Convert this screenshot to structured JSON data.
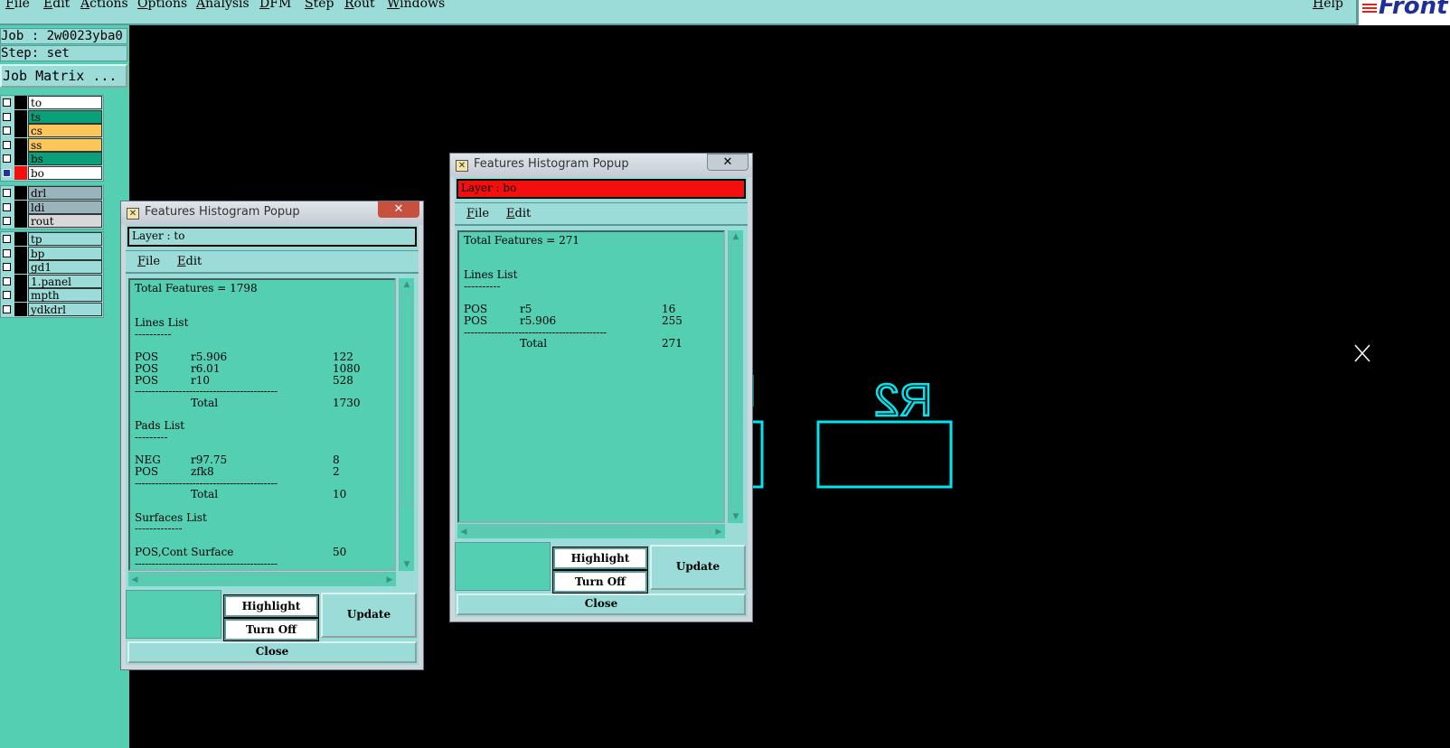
{
  "menubar": {
    "items": [
      "File",
      "Edit",
      "Actions",
      "Options",
      "Analysis",
      "DFM",
      "Step",
      "Rout",
      "Windows"
    ],
    "help": "Help",
    "logo_text": "Front"
  },
  "left_panel": {
    "job": "Job : 2w0023yba0",
    "step": "Step: set",
    "job_matrix": "Job Matrix ...",
    "layers_group1": [
      {
        "name": "to",
        "color": "#ffffff"
      },
      {
        "name": "ts",
        "color": "#0aa07a"
      },
      {
        "name": "cs",
        "color": "#fbc75b"
      },
      {
        "name": "ss",
        "color": "#fbc75b"
      },
      {
        "name": "bs",
        "color": "#0aa07a"
      },
      {
        "name": "bo",
        "color": "#ffffff"
      }
    ],
    "layers_group2": [
      {
        "name": "drl",
        "color": "#9ab4bc"
      },
      {
        "name": "ldi",
        "color": "#9ab4bc"
      },
      {
        "name": "rout",
        "color": "#d8d8d8"
      }
    ],
    "layers_group3": [
      {
        "name": "tp",
        "color": "#9bdcd8"
      },
      {
        "name": "bp",
        "color": "#9bdcd8"
      },
      {
        "name": "gd1",
        "color": "#9bdcd8"
      },
      {
        "name": "1.panel",
        "color": "#9bdcd8"
      },
      {
        "name": "mpth",
        "color": "#9bdcd8"
      },
      {
        "name": "ydkdrl",
        "color": "#9bdcd8"
      }
    ]
  },
  "popup_left": {
    "title": "Features Histogram Popup",
    "close_glyph": "✕",
    "layer_label": "Layer :  to",
    "menu": [
      "File",
      "Edit"
    ],
    "lines": [
      [
        "Total Features = 1798",
        "",
        ""
      ],
      [
        "",
        "",
        ""
      ],
      [
        "",
        "",
        ""
      ],
      [
        "Lines List",
        "",
        ""
      ],
      [
        "----------",
        "",
        ""
      ],
      [
        "",
        "",
        ""
      ],
      [
        "POS",
        "r5.906",
        "122"
      ],
      [
        "POS",
        "r6.01",
        "1080"
      ],
      [
        "POS",
        "r10",
        "528"
      ],
      [
        "------------------------------------------",
        "",
        ""
      ],
      [
        "",
        "Total",
        "1730"
      ],
      [
        "",
        "",
        ""
      ],
      [
        "Pads List",
        "",
        ""
      ],
      [
        "---------",
        "",
        ""
      ],
      [
        "",
        "",
        ""
      ],
      [
        "NEG",
        "r97.75",
        "8"
      ],
      [
        "POS",
        "zfk8",
        "2"
      ],
      [
        "------------------------------------------",
        "",
        ""
      ],
      [
        "",
        "Total",
        "10"
      ],
      [
        "",
        "",
        ""
      ],
      [
        "Surfaces List",
        "",
        ""
      ],
      [
        "-------------",
        "",
        ""
      ],
      [
        "",
        "",
        ""
      ],
      [
        "POS,Cont Surface",
        "",
        "50"
      ],
      [
        "------------------------------------------",
        "",
        ""
      ]
    ],
    "highlight": "Highlight",
    "turn_off": "Turn Off",
    "update": "Update",
    "close": "Close"
  },
  "popup_right": {
    "title": "Features Histogram Popup",
    "close_glyph": "✕",
    "layer_label": "Layer :  bo",
    "layer_bg": "#f40f0f",
    "menu": [
      "File",
      "Edit"
    ],
    "lines": [
      [
        "Total Features = 271",
        "",
        ""
      ],
      [
        "",
        "",
        ""
      ],
      [
        "",
        "",
        ""
      ],
      [
        "Lines List",
        "",
        ""
      ],
      [
        "----------",
        "",
        ""
      ],
      [
        "",
        "",
        ""
      ],
      [
        "POS",
        "r5",
        "16"
      ],
      [
        "POS",
        "r5.906",
        "255"
      ],
      [
        "------------------------------------------",
        "",
        ""
      ],
      [
        "",
        "Total",
        "271"
      ]
    ],
    "highlight": "Highlight",
    "turn_off": "Turn Off",
    "update": "Update",
    "close": "Close"
  },
  "canvas": {
    "component_label": "R2",
    "graphic_color": "#00e5f0"
  },
  "colors": {
    "panel_light": "#9bdcd8",
    "panel_mid": "#55cfb2",
    "background": "#000000"
  }
}
